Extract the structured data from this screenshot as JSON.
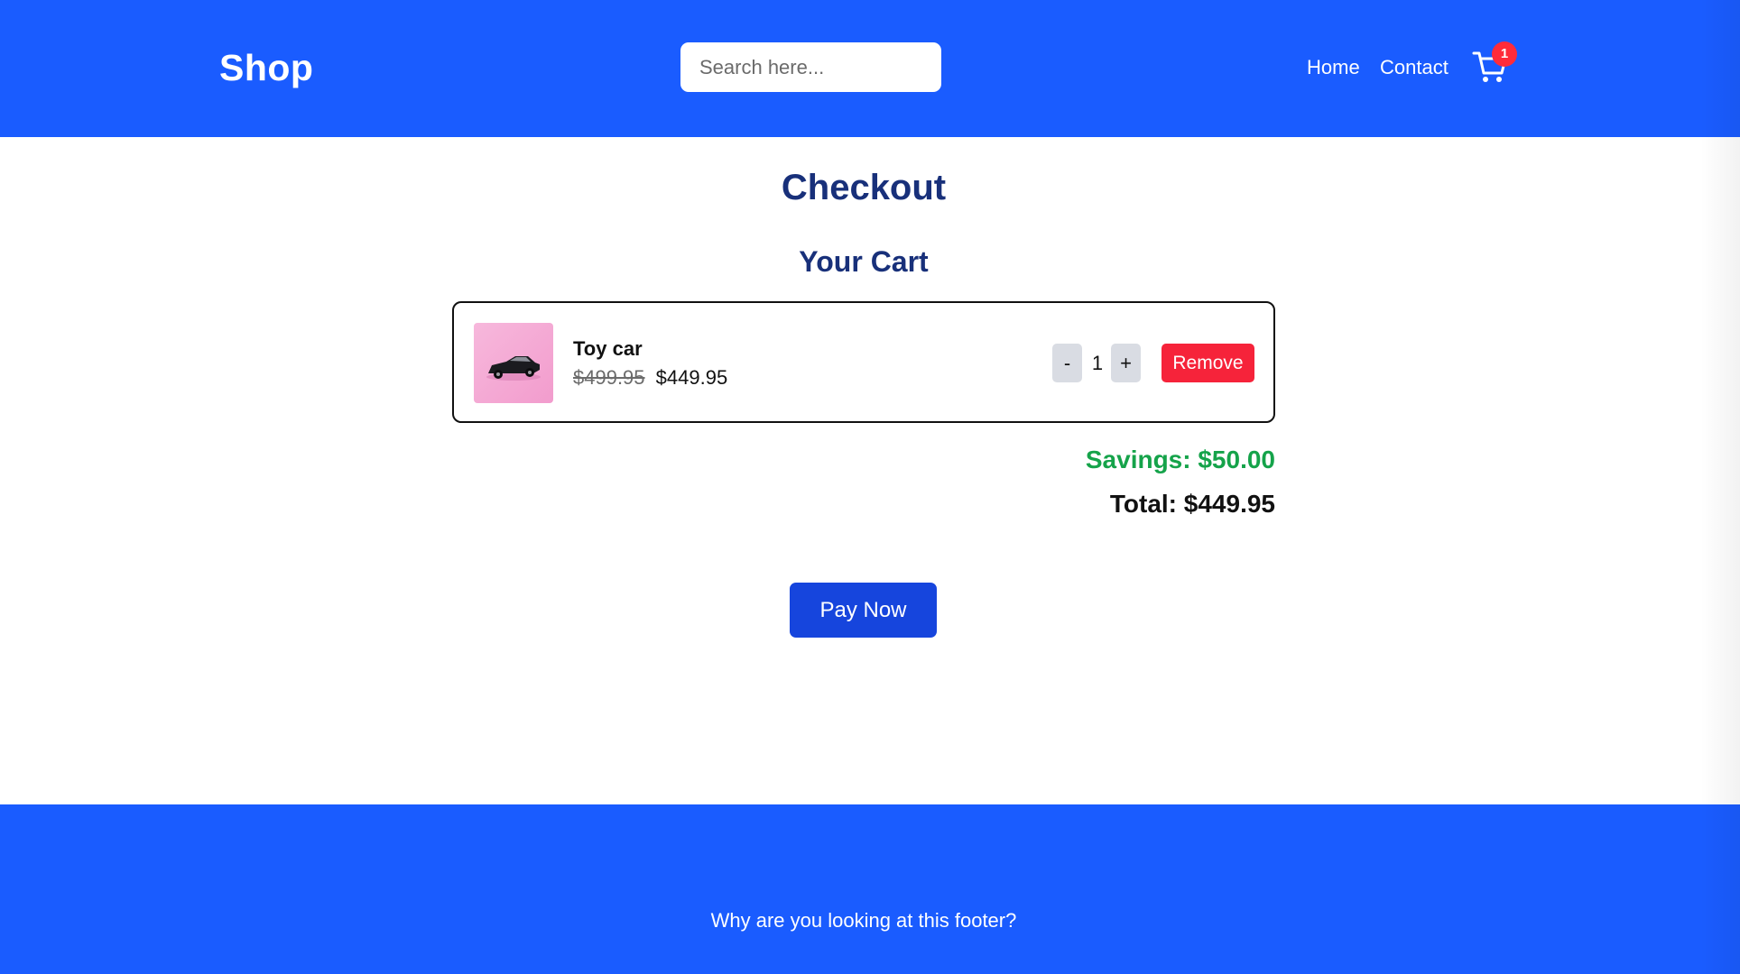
{
  "colors": {
    "brand_blue": "#1a5cff",
    "heading_navy": "#18307a",
    "savings_green": "#15a34a",
    "remove_red": "#f6233a",
    "pay_button_blue": "#1645dd",
    "badge_red": "#ff2b3a"
  },
  "header": {
    "logo": "Shop",
    "search": {
      "placeholder": "Search here...",
      "value": ""
    },
    "nav": {
      "home": "Home",
      "contact": "Contact"
    },
    "cart": {
      "icon": "shopping-cart-icon",
      "badge_count": "1"
    }
  },
  "main": {
    "title": "Checkout",
    "cart_title": "Your Cart",
    "items": [
      {
        "name": "Toy car",
        "image_icon": "toy-car-thumbnail",
        "original_price": "$499.95",
        "price": "$449.95",
        "quantity": "1",
        "decrement_label": "-",
        "increment_label": "+",
        "remove_label": "Remove"
      }
    ],
    "savings": "Savings: $50.00",
    "total": "Total: $449.95",
    "pay_label": "Pay Now"
  },
  "footer": {
    "text": "Why are you looking at this footer?"
  }
}
